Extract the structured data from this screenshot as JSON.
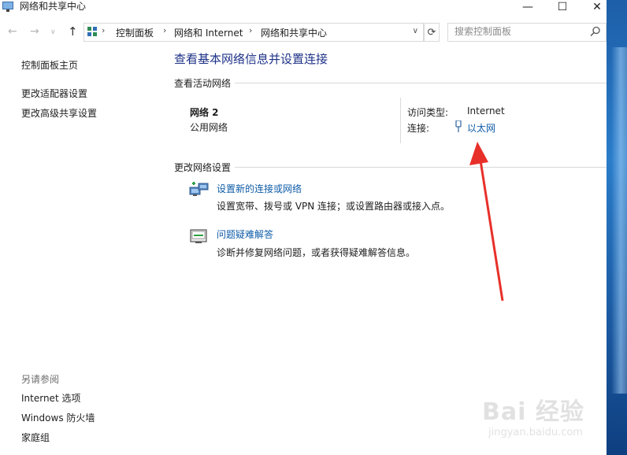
{
  "window": {
    "title": "网络和共享中心",
    "controls": {
      "minimize": "—",
      "maximize": "☐",
      "close": "✕"
    }
  },
  "navbar": {
    "back": "←",
    "forward": "→",
    "recent": "∨",
    "up": "↑",
    "breadcrumb": [
      "控制面板",
      "网络和 Internet",
      "网络和共享中心"
    ],
    "separator": "›",
    "dropdown": "∨",
    "refresh": "⟳",
    "search_placeholder": "搜索控制面板"
  },
  "sidebar": {
    "home": "控制面板主页",
    "items": [
      "更改适配器设置",
      "更改高级共享设置"
    ],
    "see_also_title": "另请参阅",
    "see_also": [
      "Internet 选项",
      "Windows 防火墙",
      "家庭组"
    ]
  },
  "main": {
    "title": "查看基本网络信息并设置连接",
    "active_networks_heading": "查看活动网络",
    "network": {
      "name": "网络 2",
      "type": "公用网络",
      "access_label": "访问类型:",
      "access_value": "Internet",
      "connection_label": "连接:",
      "connection_value": "以太网"
    },
    "change_settings_heading": "更改网络设置",
    "actions": [
      {
        "link": "设置新的连接或网络",
        "desc": "设置宽带、拨号或 VPN 连接；或设置路由器或接入点。"
      },
      {
        "link": "问题疑难解答",
        "desc": "诊断并修复网络问题，或者获得疑难解答信息。"
      }
    ]
  },
  "watermark": {
    "brand": "Bai 经验",
    "url": "jingyan.baidu.com"
  },
  "colors": {
    "title_blue": "#1e3287",
    "link_blue": "#0f5ca8",
    "annotation_red": "#e8302a"
  }
}
